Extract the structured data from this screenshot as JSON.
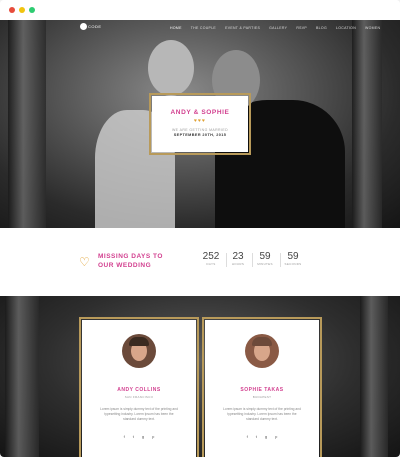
{
  "nav": {
    "logo": "CODE",
    "items": [
      "HOME",
      "THE COUPLE",
      "EVENT & PARTIES",
      "GALLERY",
      "RSVP",
      "BLOG",
      "LOCATION",
      "WOMEN"
    ]
  },
  "hero": {
    "names": "ANDY & SOPHIE",
    "hearts": "♥♥♥",
    "subtitle": "WE ARE GETTING MARRIED",
    "date": "SEPTEMBER 20TH, 2015"
  },
  "countdown": {
    "title_line1": "MISSING DAYS TO",
    "title_line2": "OUR WEDDING",
    "units": [
      {
        "value": "252",
        "label": "DAYS"
      },
      {
        "value": "23",
        "label": "HOURS"
      },
      {
        "value": "59",
        "label": "MINUTES"
      },
      {
        "value": "59",
        "label": "SECONDS"
      }
    ]
  },
  "people": [
    {
      "name": "ANDY COLLINS",
      "location": "SAN FRANCISCO",
      "bio": "Lorem ipsum is simply dummy text of the printing and typesetting industry. Lorem Ipsum has been the standard dummy text.",
      "social": [
        "f",
        "t",
        "g",
        "p"
      ]
    },
    {
      "name": "SOPHIE TAKAS",
      "location": "BUDAPEST",
      "bio": "Lorem ipsum is simply dummy text of the printing and typesetting industry. Lorem Ipsum has been the standard dummy text.",
      "social": [
        "f",
        "t",
        "g",
        "p"
      ]
    }
  ],
  "colors": {
    "accent": "#d23f8f",
    "gold": "#b89a5a",
    "heart": "#e0a132"
  }
}
